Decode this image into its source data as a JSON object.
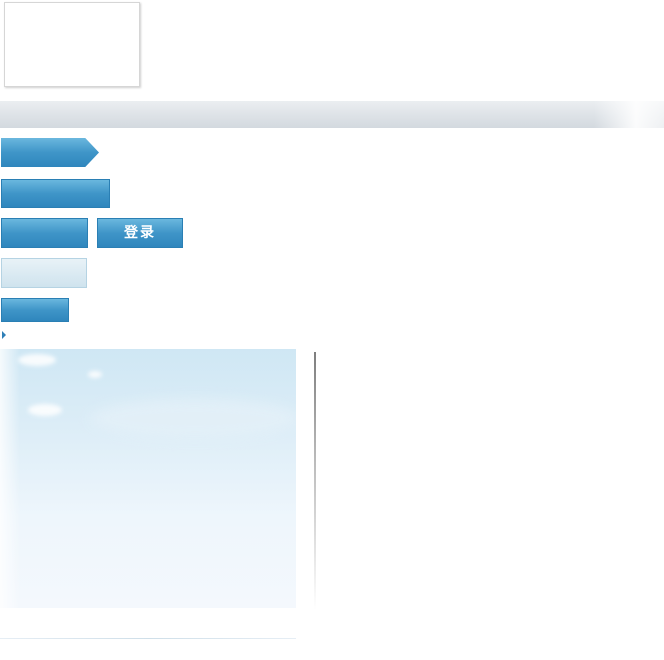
{
  "login_button": {
    "label": "登录"
  }
}
